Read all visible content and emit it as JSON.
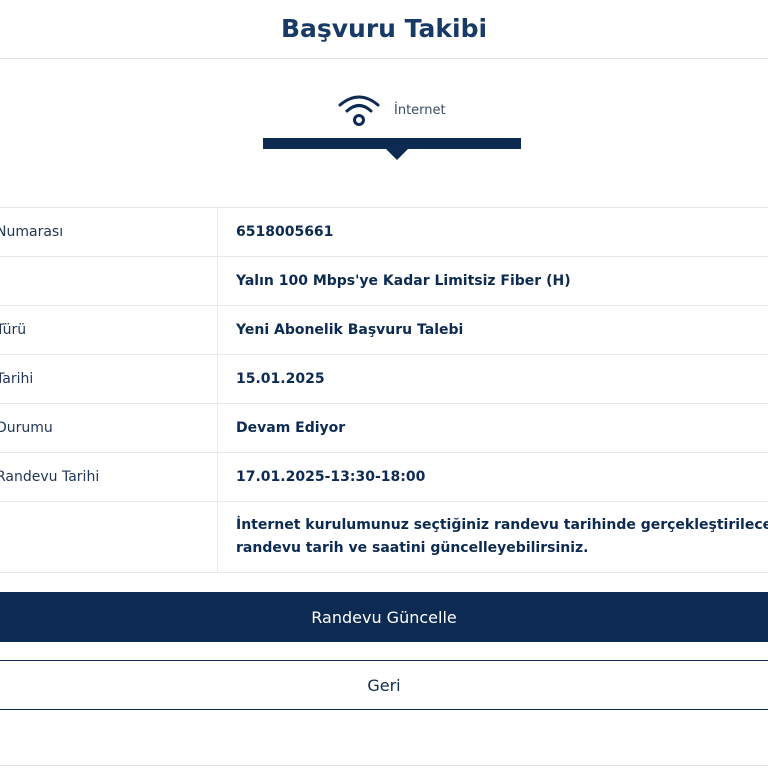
{
  "header": {
    "title": "Başvuru Takibi"
  },
  "service": {
    "icon": "wifi-icon",
    "label": "İnternet"
  },
  "details": [
    {
      "key": "application-number",
      "label": "Numarası",
      "value": "6518005661"
    },
    {
      "key": "package",
      "label": "",
      "value": "Yalın 100 Mbps'ye Kadar Limitsiz Fiber (H)"
    },
    {
      "key": "application-type",
      "label": "Türü",
      "value": "Yeni Abonelik Başvuru Talebi"
    },
    {
      "key": "application-date",
      "label": "Tarihi",
      "value": "15.01.2025"
    },
    {
      "key": "application-status",
      "label": "Durumu",
      "value": "Devam Ediyor"
    },
    {
      "key": "appointment-date",
      "label": "Randevu Tarihi",
      "value": "17.01.2025-13:30-18:00"
    },
    {
      "key": "info-note",
      "label": "",
      "value_lines": [
        "İnternet kurulumunuz seçtiğiniz randevu tarihinde gerçekleştirilecektir.",
        "randevu tarih ve saatini güncelleyebilirsiniz."
      ]
    }
  ],
  "actions": {
    "update_appointment_label": "Randevu Güncelle",
    "back_label": "Geri"
  },
  "colors": {
    "brand_navy": "#0d2b52",
    "title": "#173a66",
    "divider": "#e6e9ed"
  }
}
